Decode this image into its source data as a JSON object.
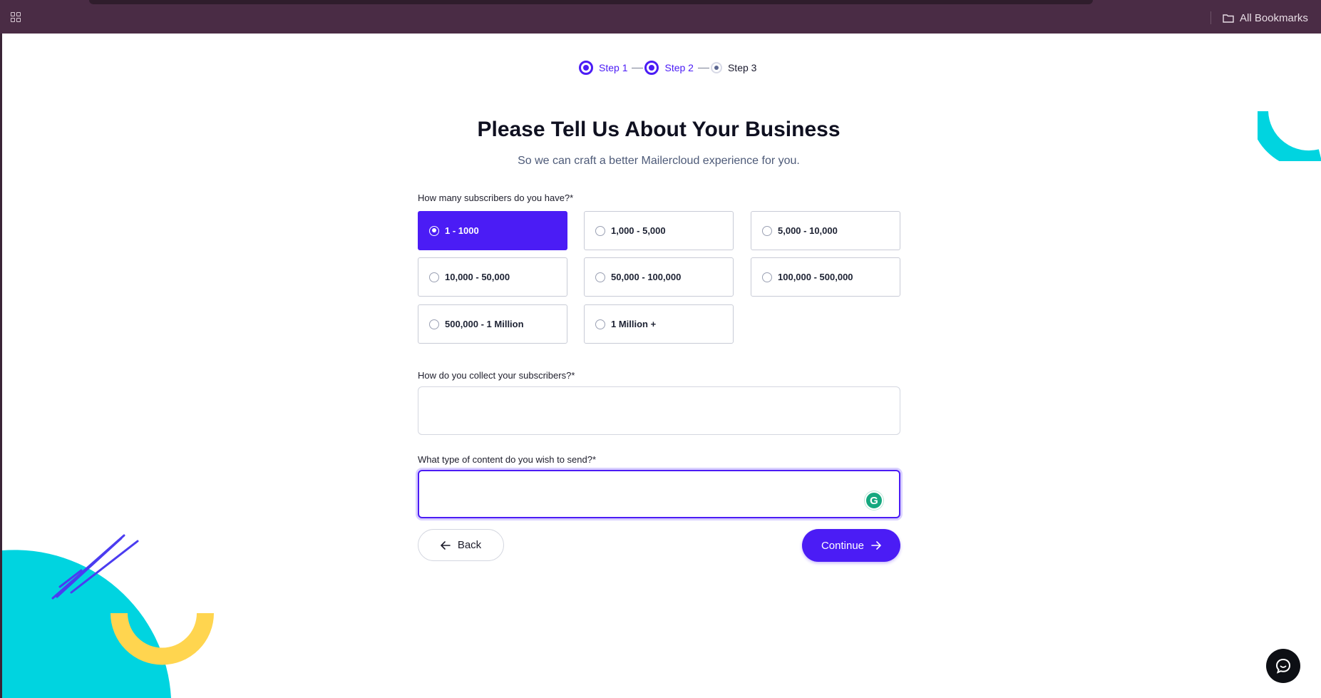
{
  "browser": {
    "bookmarks_label": "All Bookmarks"
  },
  "stepper": {
    "steps": [
      {
        "label": "Step 1",
        "state": "completed"
      },
      {
        "label": "Step 2",
        "state": "active"
      },
      {
        "label": "Step 3",
        "state": "pending"
      }
    ]
  },
  "page": {
    "title": "Please Tell Us About Your Business",
    "subtitle": "So we can craft a better Mailercloud experience for you."
  },
  "subscribers": {
    "question": "How many subscribers do you have?*",
    "options": [
      {
        "label": "1 - 1000",
        "selected": true
      },
      {
        "label": "1,000 - 5,000",
        "selected": false
      },
      {
        "label": "5,000 - 10,000",
        "selected": false
      },
      {
        "label": "10,000 - 50,000",
        "selected": false
      },
      {
        "label": "50,000 - 100,000",
        "selected": false
      },
      {
        "label": "100,000 - 500,000",
        "selected": false
      },
      {
        "label": "500,000 - 1 Million",
        "selected": false
      },
      {
        "label": "1 Million +",
        "selected": false
      }
    ]
  },
  "collect": {
    "question": "How do you collect your subscribers?*",
    "value": ""
  },
  "content_type": {
    "question": "What type of content do you wish to send?*",
    "value": ""
  },
  "actions": {
    "back_label": "Back",
    "continue_label": "Continue"
  },
  "colors": {
    "primary": "#4b1cf5",
    "topbar": "#4a2c45",
    "cyan": "#00d4e0",
    "yellow": "#ffd54f"
  }
}
